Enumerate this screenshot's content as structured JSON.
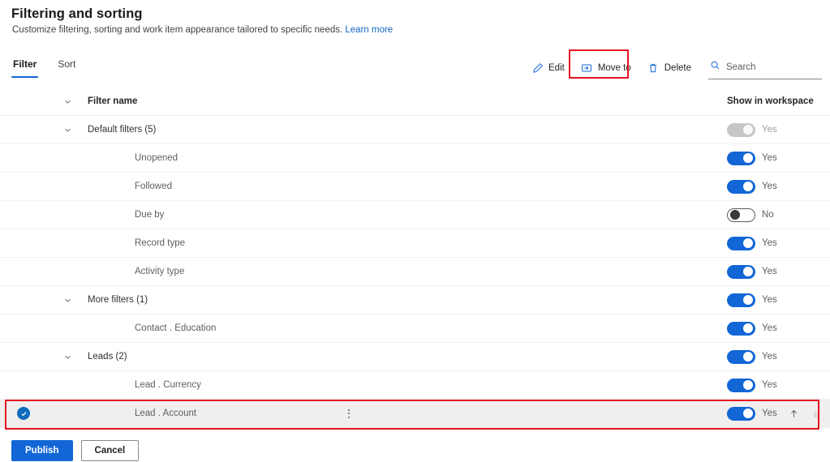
{
  "header": {
    "title": "Filtering and sorting",
    "subtitle": "Customize filtering, sorting and work item appearance tailored to specific needs.",
    "learn_more": "Learn more"
  },
  "tabs": [
    {
      "label": "Filter",
      "active": true
    },
    {
      "label": "Sort",
      "active": false
    }
  ],
  "toolbar": {
    "edit_label": "Edit",
    "move_to_label": "Move to",
    "delete_label": "Delete",
    "search_placeholder": "Search",
    "search_value": "",
    "highlight_color": "#e81123"
  },
  "table": {
    "columns": {
      "name": "Filter name",
      "workspace": "Show in workspace"
    },
    "rows": [
      {
        "label": "Default filters (5)",
        "type": "group",
        "toggle": "disabled",
        "toggle_label": "Yes"
      },
      {
        "label": "Unopened",
        "type": "item",
        "toggle": "on",
        "toggle_label": "Yes"
      },
      {
        "label": "Followed",
        "type": "item",
        "toggle": "on",
        "toggle_label": "Yes"
      },
      {
        "label": "Due by",
        "type": "item",
        "toggle": "off",
        "toggle_label": "No"
      },
      {
        "label": "Record type",
        "type": "item",
        "toggle": "on",
        "toggle_label": "Yes"
      },
      {
        "label": "Activity type",
        "type": "item",
        "toggle": "on",
        "toggle_label": "Yes"
      },
      {
        "label": "More filters (1)",
        "type": "group",
        "toggle": "on",
        "toggle_label": "Yes"
      },
      {
        "label": "Contact . Education",
        "type": "item",
        "toggle": "on",
        "toggle_label": "Yes"
      },
      {
        "label": "Leads (2)",
        "type": "group",
        "toggle": "on",
        "toggle_label": "Yes"
      },
      {
        "label": "Lead . Currency",
        "type": "item",
        "toggle": "on",
        "toggle_label": "Yes"
      },
      {
        "label": "Lead . Account",
        "type": "selected",
        "toggle": "on",
        "toggle_label": "Yes"
      }
    ]
  },
  "footer": {
    "publish_label": "Publish",
    "cancel_label": "Cancel"
  },
  "colors": {
    "accent": "#1266d6",
    "link": "#1565c0",
    "highlight": "#e81123",
    "toggle_on": "#1266d6",
    "toggle_disabled": "#c8c6c4"
  }
}
